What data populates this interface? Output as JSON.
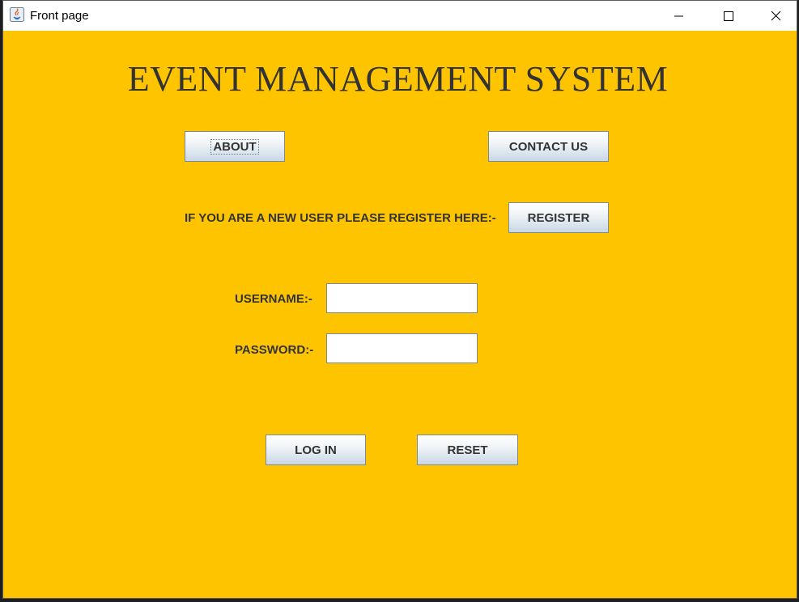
{
  "window": {
    "title": "Front page"
  },
  "main": {
    "heading": "EVENT MANAGEMENT SYSTEM",
    "about_label": "ABOUT",
    "contact_label": "CONTACT US",
    "register_prompt": "IF YOU ARE A NEW USER PLEASE REGISTER HERE:-",
    "register_label": "REGISTER",
    "username_label": "USERNAME:-",
    "username_value": "",
    "password_label": "PASSWORD:-",
    "password_value": "",
    "login_label": "LOG IN",
    "reset_label": "RESET"
  },
  "colors": {
    "background": "#ffc400",
    "text": "#333333",
    "button_border": "#7a8a99"
  },
  "icons": {
    "app": "java-icon",
    "minimize": "minimize-icon",
    "maximize": "maximize-icon",
    "close": "close-icon"
  }
}
